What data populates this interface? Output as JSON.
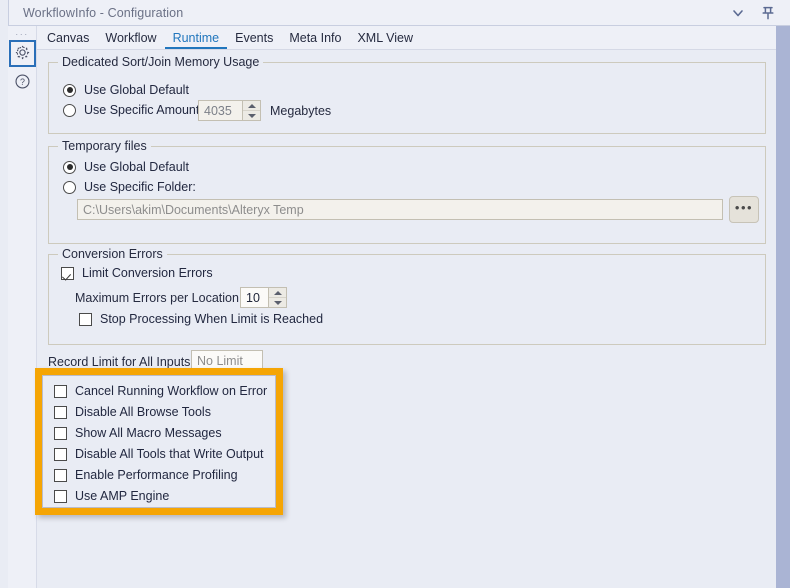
{
  "window": {
    "title": "WorkflowInfo - Configuration",
    "collapse_icon": "chevron-down-icon",
    "pin_icon": "pin-icon"
  },
  "rail": {
    "dots": "···",
    "items": [
      {
        "name": "configuration-gear",
        "icon": "gear-icon",
        "selected": true
      },
      {
        "name": "help",
        "icon": "question-circle-icon",
        "selected": false
      }
    ]
  },
  "tabs": [
    {
      "label": "Canvas",
      "active": false
    },
    {
      "label": "Workflow",
      "active": false
    },
    {
      "label": "Runtime",
      "active": true
    },
    {
      "label": "Events",
      "active": false
    },
    {
      "label": "Meta Info",
      "active": false
    },
    {
      "label": "XML View",
      "active": false
    }
  ],
  "memory_group": {
    "legend": "Dedicated Sort/Join Memory Usage",
    "use_global_default": {
      "label": "Use Global Default",
      "selected": true
    },
    "use_specific_amount": {
      "label": "Use Specific Amount:",
      "selected": false
    },
    "amount_value": "4035",
    "units_label": "Megabytes"
  },
  "temp_files_group": {
    "legend": "Temporary files",
    "use_global_default": {
      "label": "Use Global Default",
      "selected": true
    },
    "use_specific_folder": {
      "label": "Use Specific Folder:",
      "selected": false
    },
    "folder_path": "C:\\Users\\akim\\Documents\\Alteryx Temp",
    "browse_label": "•••"
  },
  "conversion_errors_group": {
    "legend": "Conversion Errors",
    "limit_conversion_errors": {
      "label": "Limit Conversion Errors",
      "checked": true
    },
    "max_errors_label": "Maximum Errors per Location:",
    "max_errors_value": "10",
    "stop_processing": {
      "label": "Stop Processing When Limit is Reached",
      "checked": false
    }
  },
  "record_limit": {
    "label": "Record Limit for All Inputs:",
    "placeholder": "No Limit",
    "value": ""
  },
  "options": {
    "items": [
      {
        "label": "Cancel Running Workflow on Error",
        "checked": false
      },
      {
        "label": "Disable All Browse Tools",
        "checked": false
      },
      {
        "label": "Show All Macro Messages",
        "checked": false
      },
      {
        "label": "Disable All Tools that Write Output",
        "checked": false
      },
      {
        "label": "Enable Performance Profiling",
        "checked": false
      },
      {
        "label": "Use AMP Engine",
        "checked": false
      }
    ],
    "highlight_color": "#f5a504"
  },
  "colors": {
    "background": "#e9ecf4",
    "accent_tab": "#2176bd",
    "highlight": "#f5a504",
    "rail_selected_border": "#2a6fb8"
  }
}
